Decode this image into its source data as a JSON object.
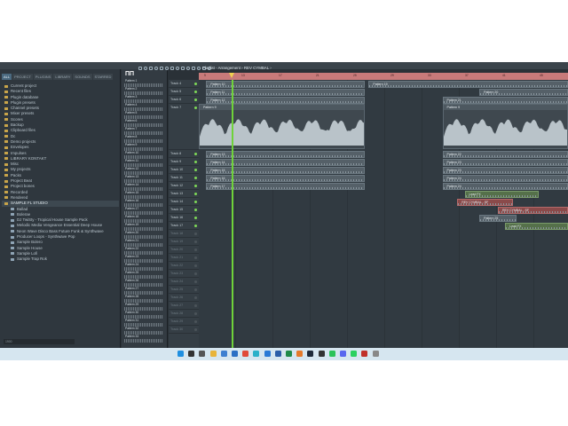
{
  "playlist": {
    "title": "Playlist - Arrangement › REV CYMBAL ›"
  },
  "browser": {
    "tabs": [
      "ALL",
      "PROJECT",
      "PLUGINS",
      "LIBRARY",
      "SOUNDS",
      "STARRED"
    ],
    "tree": [
      {
        "label": "Current project",
        "open": false,
        "sub": false
      },
      {
        "label": "Recent files",
        "open": false,
        "sub": false
      },
      {
        "label": "Plugin database",
        "open": false,
        "sub": false
      },
      {
        "label": "Plugin presets",
        "open": false,
        "sub": false
      },
      {
        "label": "Channel presets",
        "open": false,
        "sub": false
      },
      {
        "label": "Mixer presets",
        "open": false,
        "sub": false
      },
      {
        "label": "Scores",
        "open": false,
        "sub": false
      },
      {
        "label": "Backup",
        "open": false,
        "sub": false
      },
      {
        "label": "Clipboard files",
        "open": false,
        "sub": false
      },
      {
        "label": "Dc",
        "open": false,
        "sub": false
      },
      {
        "label": "Demo projects",
        "open": false,
        "sub": false
      },
      {
        "label": "Envelopes",
        "open": false,
        "sub": false
      },
      {
        "label": "Impulses",
        "open": false,
        "sub": false
      },
      {
        "label": "LIBRARY KONTAKT",
        "open": false,
        "sub": false
      },
      {
        "label": "Misc",
        "open": false,
        "sub": false
      },
      {
        "label": "My projects",
        "open": false,
        "sub": false
      },
      {
        "label": "Packs",
        "open": false,
        "sub": false
      },
      {
        "label": "Project Beat",
        "open": false,
        "sub": false
      },
      {
        "label": "Project bones",
        "open": false,
        "sub": false
      },
      {
        "label": "Recorded",
        "open": false,
        "sub": false
      },
      {
        "label": "Rendered",
        "open": false,
        "sub": false
      },
      {
        "label": "SAMPLE FL STUDIO",
        "open": true,
        "sub": false
      },
      {
        "label": "Ballad",
        "open": false,
        "sub": true
      },
      {
        "label": "Bolerae",
        "open": false,
        "sub": true
      },
      {
        "label": "DJ TwiSty - Tropical House Sample Pack",
        "open": false,
        "sub": true
      },
      {
        "label": "Melodic Media Vengeance Essential Deep House",
        "open": false,
        "sub": true
      },
      {
        "label": "Neon Wave Disco Bass Future Funk & Synthwave",
        "open": false,
        "sub": true
      },
      {
        "label": "Producer Loops - Synthwave Pop",
        "open": false,
        "sub": true
      },
      {
        "label": "Sample Bolero",
        "open": false,
        "sub": true
      },
      {
        "label": "Sample House",
        "open": false,
        "sub": true
      },
      {
        "label": "Sample Lofi",
        "open": false,
        "sub": true
      },
      {
        "label": "Sample Trap Rok",
        "open": false,
        "sub": true
      }
    ],
    "footer": "1900"
  },
  "picker": {
    "header_icon": "ΠΠ",
    "patterns": [
      "Pattern 1",
      "Pattern 2",
      "Pattern 3",
      "Pattern 4",
      "Pattern 5",
      "Pattern 6",
      "Pattern 7",
      "Pattern 8",
      "Pattern 9",
      "Pattern 10",
      "Pattern 11",
      "Pattern 12",
      "Pattern 13",
      "Pattern 14",
      "Pattern 15",
      "Pattern 16",
      "Pattern 17",
      "Pattern 18",
      "Pattern 19",
      "Pattern 20",
      "Pattern 21",
      "Pattern 22",
      "Pattern 23",
      "Pattern 24",
      "Pattern 25",
      "Pattern 26",
      "Pattern 27",
      "Pattern 28",
      "Pattern 29",
      "Pattern 30",
      "Pattern 31",
      "Pattern 32",
      "Pattern 33"
    ]
  },
  "tracks": [
    "Track 4",
    "Track 5",
    "Track 6",
    "Track 7",
    "Track 8",
    "Track 9",
    "Track 10",
    "Track 11",
    "Track 12",
    "Track 13",
    "Track 14",
    "Track 15",
    "Track 16",
    "Track 17",
    "Track 18",
    "Track 19",
    "Track 20",
    "Track 21",
    "Track 22",
    "Track 23",
    "Track 24",
    "Track 25",
    "Track 26",
    "Track 27",
    "Track 28",
    "Track 29",
    "Track 30"
  ],
  "ruler_numbers": [
    "9",
    "13",
    "17",
    "21",
    "25",
    "29",
    "33",
    "37",
    "41",
    "45"
  ],
  "clips": [
    {
      "label": "Pattern 10",
      "row": 0,
      "start": 0.02,
      "width": 0.43,
      "style": ""
    },
    {
      "label": "Pattern 19",
      "row": 0,
      "start": 0.46,
      "width": 0.54,
      "style": ""
    },
    {
      "label": "Pattern 11",
      "row": 1,
      "start": 0.02,
      "width": 0.43,
      "style": ""
    },
    {
      "label": "Pattern 20",
      "row": 1,
      "start": 0.76,
      "width": 0.24,
      "style": ""
    },
    {
      "label": "Pattern 12",
      "row": 2,
      "start": 0.02,
      "width": 0.43,
      "style": ""
    },
    {
      "label": "Pattern 21",
      "row": 2,
      "start": 0.66,
      "width": 0.34,
      "style": ""
    },
    {
      "label": "Pattern 13",
      "row": 4,
      "start": 0.02,
      "width": 0.43,
      "style": ""
    },
    {
      "label": "Pattern 22",
      "row": 4,
      "start": 0.66,
      "width": 0.34,
      "style": ""
    },
    {
      "label": "Pattern 14",
      "row": 5,
      "start": 0.02,
      "width": 0.43,
      "style": ""
    },
    {
      "label": "Pattern 23",
      "row": 5,
      "start": 0.66,
      "width": 0.34,
      "style": ""
    },
    {
      "label": "Pattern 15",
      "row": 6,
      "start": 0.02,
      "width": 0.43,
      "style": ""
    },
    {
      "label": "Pattern 23",
      "row": 6,
      "start": 0.66,
      "width": 0.34,
      "style": ""
    },
    {
      "label": "Pattern 16",
      "row": 7,
      "start": 0.02,
      "width": 0.43,
      "style": ""
    },
    {
      "label": "Pattern 24",
      "row": 7,
      "start": 0.66,
      "width": 0.34,
      "style": ""
    },
    {
      "label": "Pattern 17",
      "row": 8,
      "start": 0.02,
      "width": 0.43,
      "style": ""
    },
    {
      "label": "Pattern 24",
      "row": 8,
      "start": 0.66,
      "width": 0.34,
      "style": ""
    },
    {
      "label": "Lead FX",
      "row": 9,
      "start": 0.72,
      "width": 0.2,
      "style": "green"
    },
    {
      "label": "REV CYMBAL - SF",
      "row": 10,
      "start": 0.7,
      "width": 0.15,
      "style": "red"
    },
    {
      "label": "REV CYMBAL - SF",
      "row": 11,
      "start": 0.81,
      "width": 0.19,
      "style": "red"
    },
    {
      "label": "Pattern 25",
      "row": 12,
      "start": 0.76,
      "width": 0.1,
      "style": ""
    },
    {
      "label": "Lead FX",
      "row": 13,
      "start": 0.83,
      "width": 0.17,
      "style": "green"
    }
  ],
  "audio_clips": [
    {
      "label": "Pattern 9",
      "start": 0.0,
      "width": 0.45
    },
    {
      "label": "Pattern 9",
      "start": 0.66,
      "width": 0.34
    }
  ],
  "taskbar_icons": [
    "windows-icon",
    "search-icon",
    "taskview-icon",
    "explorer-icon",
    "store-icon",
    "mail-icon",
    "chrome-icon",
    "edge-icon",
    "vscode-icon",
    "word-icon",
    "excel-icon",
    "flstudio-icon",
    "steam-icon",
    "obs-icon",
    "spotify-icon",
    "discord-icon",
    "whatsapp-icon",
    "record-icon",
    "misc-icon"
  ],
  "colors": {
    "accent": "#6fd23a",
    "ruler": "#c87a7a",
    "taskbar": "#d6e6f0"
  }
}
